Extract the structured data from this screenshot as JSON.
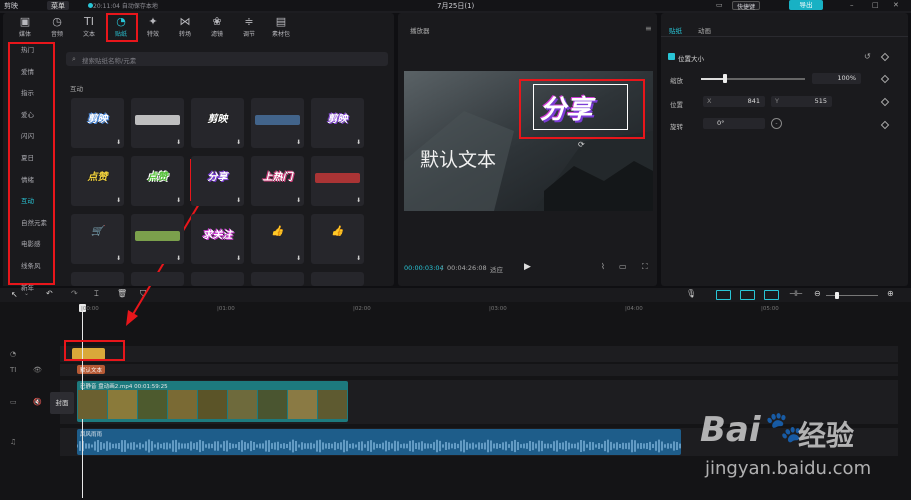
{
  "app": {
    "name": "剪映",
    "menu_label": "菜单",
    "autosave": "20:11:04 自动保存本地",
    "date": "7月25日(1)",
    "shortcut_label": "快捷键",
    "export_label": "导出"
  },
  "toolbar": {
    "items": [
      {
        "label": "媒体",
        "icon": "media-icon"
      },
      {
        "label": "音频",
        "icon": "audio-icon"
      },
      {
        "label": "文本",
        "icon": "text-icon"
      },
      {
        "label": "贴纸",
        "icon": "sticker-icon"
      },
      {
        "label": "特效",
        "icon": "effect-icon"
      },
      {
        "label": "转场",
        "icon": "transition-icon"
      },
      {
        "label": "滤镜",
        "icon": "filter-icon"
      },
      {
        "label": "调节",
        "icon": "adjust-icon"
      },
      {
        "label": "素材包",
        "icon": "package-icon"
      }
    ],
    "active_index": 3
  },
  "categories": {
    "items": [
      "热门",
      "爱情",
      "指示",
      "爱心",
      "闪闪",
      "夏日",
      "情绪",
      "互动",
      "自然元素",
      "电影感",
      "线条风",
      "新年"
    ],
    "active_index": 7
  },
  "library": {
    "search_placeholder": "搜索贴纸名称/元素",
    "section_title": "互动",
    "stickers": [
      {
        "text": "剪映",
        "color": "#ffffff",
        "stroke": "#4a8be0"
      },
      {
        "text": "",
        "color": "#ffffff",
        "stroke": ""
      },
      {
        "text": "剪映",
        "color": "#ffffff",
        "stroke": "#222222"
      },
      {
        "text": "",
        "color": "#4e7fb5",
        "stroke": ""
      },
      {
        "text": "剪映",
        "color": "#ffffff",
        "stroke": "#8a4bdc"
      },
      {
        "text": "点赞",
        "color": "#f2d23c",
        "stroke": "#222222"
      },
      {
        "text": "点赞",
        "color": "#56c23a",
        "stroke": "#ffffff"
      },
      {
        "text": "分享",
        "color": "#ffffff",
        "stroke": "#7b3cd6"
      },
      {
        "text": "上热门",
        "color": "#ffffff",
        "stroke": "#d23b7a"
      },
      {
        "text": "",
        "color": "#e23b3b",
        "stroke": ""
      },
      {
        "text": "🛒",
        "color": "#ffffff",
        "stroke": ""
      },
      {
        "text": "",
        "color": "#9fd45b",
        "stroke": ""
      },
      {
        "text": "求关注",
        "color": "#ffffff",
        "stroke": "#d23bd8"
      },
      {
        "text": "👍",
        "color": "#f6c3a8",
        "stroke": ""
      },
      {
        "text": "👍",
        "color": "#f6c3a8",
        "stroke": ""
      }
    ]
  },
  "player": {
    "title": "播放器",
    "text_overlay": "默认文本",
    "sticker_overlay": "分享",
    "current_time": "00:00:03:04",
    "total_time": "00:04:26:08",
    "view_mode": "适应"
  },
  "inspector": {
    "tabs": [
      "贴纸",
      "动画"
    ],
    "active_tab": 0,
    "section": "位置大小",
    "scale_label": "缩放",
    "scale_value": "100%",
    "scale_fraction": 0.22,
    "position_label": "位置",
    "pos_x_axis": "X",
    "pos_x": "841",
    "pos_y_axis": "Y",
    "pos_y": "515",
    "rotate_label": "旋转",
    "rotate_value": "0°"
  },
  "timeline": {
    "ticks": [
      "|00:00",
      "|01:00",
      "|02:00",
      "|03:00",
      "|04:00",
      "|05:00"
    ],
    "text_clip_label": "默认文本",
    "video_clip_label": "已静音  盘动画2.mp4  00:01:59:25",
    "cover_label": "封面",
    "audio_clip_label": "风风雨雨"
  },
  "colors": {
    "accent": "#29c5d6",
    "panel": "#1a1a1d",
    "annotation": "#e8161b",
    "video_clip": "#1d7a7e",
    "audio_clip": "#1e5d8a",
    "sticker_clip": "#d9a93a",
    "text_clip": "#b65a35"
  },
  "watermark": {
    "logo": "Bai",
    "logo_icon": "paw-icon",
    "logo_suffix": "经验",
    "url": "jingyan.baidu.com"
  }
}
